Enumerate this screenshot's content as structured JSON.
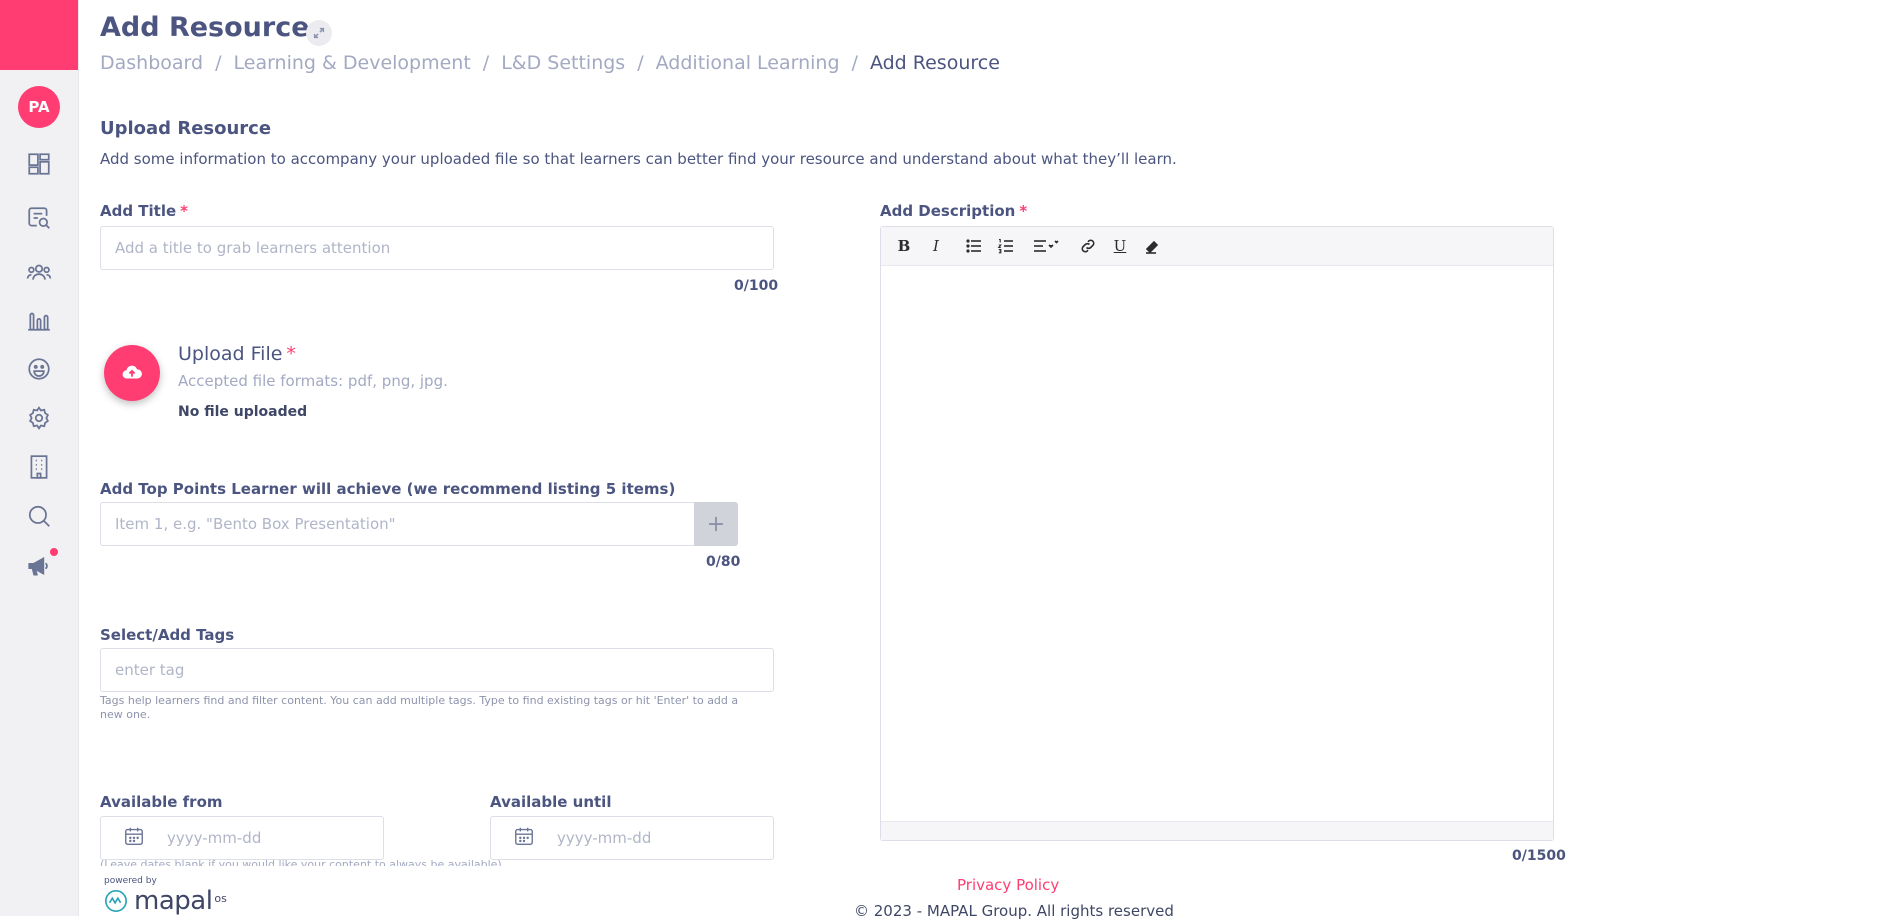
{
  "sidebar": {
    "avatar_initials": "PA",
    "items": [
      {
        "icon": "dashboard-icon"
      },
      {
        "icon": "document-search-icon"
      },
      {
        "icon": "people-icon"
      },
      {
        "icon": "bar-chart-icon"
      },
      {
        "icon": "smiley-icon"
      },
      {
        "icon": "gear-icon"
      },
      {
        "icon": "building-icon"
      },
      {
        "icon": "search-icon"
      },
      {
        "icon": "megaphone-icon"
      }
    ]
  },
  "header": {
    "title": "Add Resource",
    "breadcrumb": [
      "Dashboard",
      "Learning & Development",
      "L&D Settings",
      "Additional Learning",
      "Add Resource"
    ]
  },
  "section": {
    "title": "Upload Resource",
    "description": "Add some information to accompany your uploaded file so that learners can better find your resource and understand about what they’ll learn."
  },
  "form": {
    "title_label": "Add Title",
    "title_placeholder": "Add a title to grab learners attention",
    "title_counter": "0/100",
    "upload_title": "Upload File",
    "upload_formats": "Accepted file formats: pdf, png, jpg.",
    "upload_status": "No file uploaded",
    "points_label": "Add Top Points Learner will achieve (we recommend listing 5 items)",
    "points_placeholder": "Item 1, e.g. \"Bento Box Presentation\"",
    "points_counter": "0/80",
    "tags_label": "Select/Add Tags",
    "tags_placeholder": "enter tag",
    "tags_help": "Tags help learners find and filter content. You can add multiple tags. Type to find existing tags or hit 'Enter' to add a new one.",
    "from_label": "Available from",
    "from_placeholder": "yyyy-mm-dd",
    "until_label": "Available until",
    "until_placeholder": "yyyy-mm-dd",
    "dates_help": "(Leave dates blank if you would like your content to always be available)",
    "description_label": "Add Description",
    "description_counter": "0/1500",
    "required_mark": "*"
  },
  "colors": {
    "accent": "#ff3d72",
    "text": "#4b5580",
    "muted": "#a3a9c2"
  },
  "footer": {
    "powered_by": "powered by",
    "logo_text": "mapal",
    "logo_suffix": "os",
    "privacy": "Privacy Policy",
    "copyright": "© 2023 - MAPAL Group. All rights reserved"
  }
}
